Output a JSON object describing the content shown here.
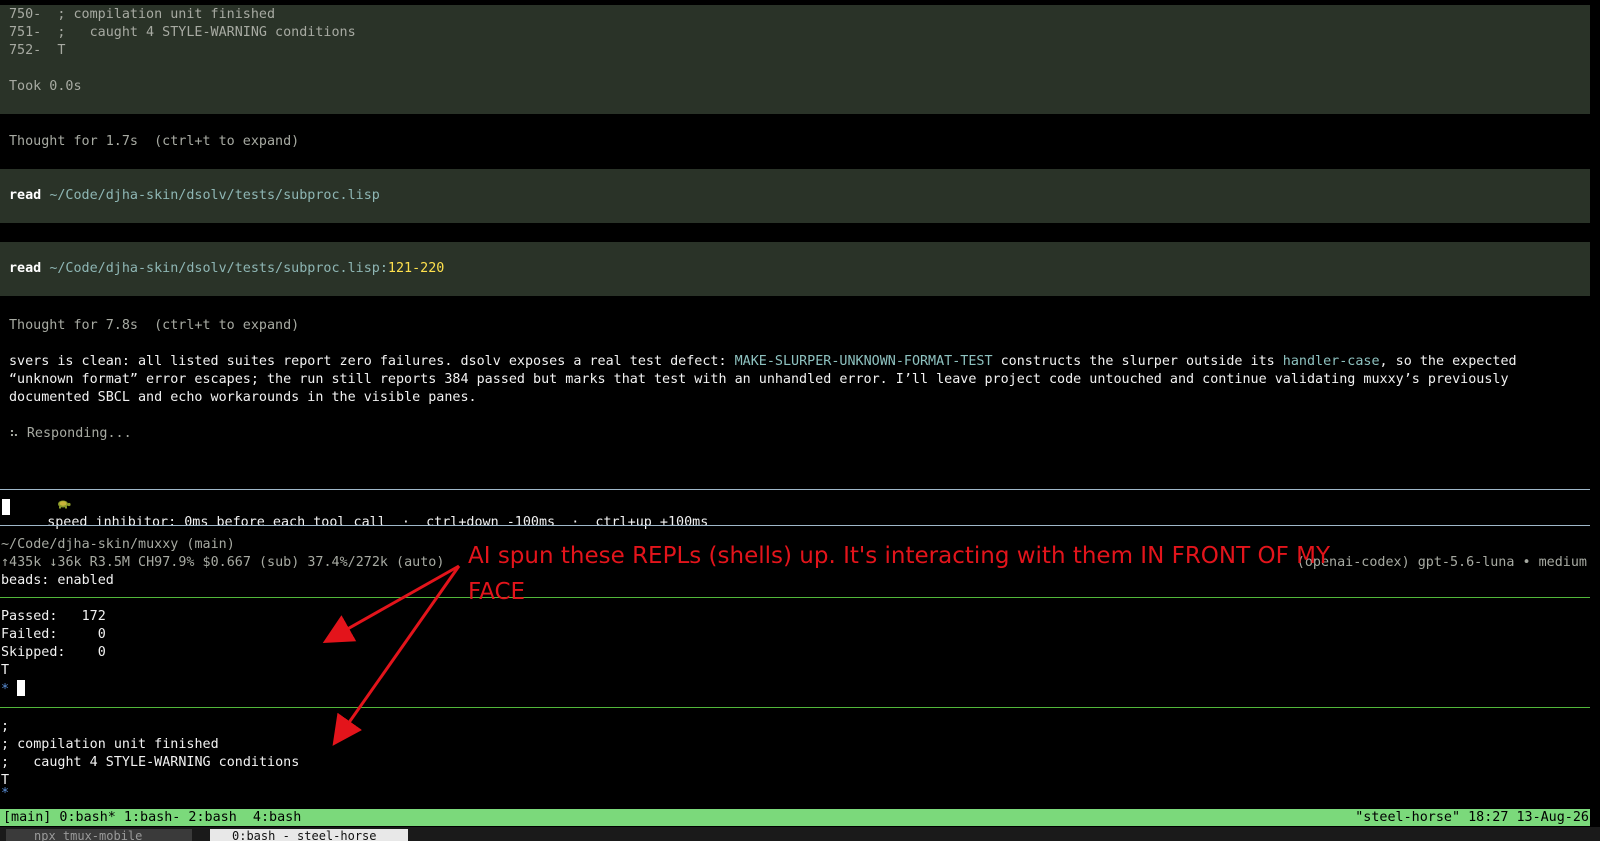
{
  "scrollback": {
    "lines": [
      "750-  ; compilation unit finished",
      "751-  ;   caught 4 STYLE-WARNING conditions",
      "752-  T"
    ],
    "took": "Took 0.0s"
  },
  "thought1": "Thought for 1.7s  (ctrl+t to expand)",
  "read1": {
    "cmd": "read",
    "path": "~/Code/djha-skin/dsolv/tests/subproc.lisp"
  },
  "read2": {
    "cmd": "read",
    "path": "~/Code/djha-skin/dsolv/tests/subproc.lisp",
    "sep": ":",
    "range": "121-220"
  },
  "thought2": "Thought for 7.8s  (ctrl+t to expand)",
  "message": {
    "l1a": "svers is clean: all listed suites report zero failures. dsolv exposes a real test defect: ",
    "l1code1": "MAKE-SLURPER-UNKNOWN-FORMAT-TEST",
    "l1b": " constructs the slurper outside its ",
    "l1code2": "handler-case",
    "l1c": ", so the expected",
    "l2": "“unknown format” error escapes; the run still reports 384 passed but marks that test with an unhandled error. I’ll leave project code untouched and continue validating muxxy’s previously",
    "l3": "documented SBCL and echo workarounds in the visible panes."
  },
  "responding": {
    "spinner": "⠦",
    "text": "Responding..."
  },
  "speed": {
    "icon": "turtle-icon",
    "text": "speed inhibitor: 0ms before each tool call  ·  ctrl+down -100ms  ·  ctrl+up +100ms"
  },
  "status": {
    "cwd": "~/Code/djha-skin/muxxy (main)",
    "stats": "↑435k ↓36k R3.5M CH97.9% $0.667 (sub) 37.4%/272k (auto)",
    "model": "(openai-codex) gpt-5.6-luna • medium",
    "beads": "beads: enabled"
  },
  "pane2": {
    "passed_label": "Passed:",
    "passed": "172",
    "failed_label": "Failed:",
    "failed": "0",
    "skipped_label": "Skipped:",
    "skipped": "0",
    "result": "T",
    "prompt": "*"
  },
  "pane3": {
    "lines": [
      ";",
      "; compilation unit finished",
      ";   caught 4 STYLE-WARNING conditions",
      "T"
    ],
    "prompt": "*"
  },
  "annotation": {
    "line1": "AI spun these REPLs (shells) up. It's interacting with them IN FRONT OF MY",
    "line2": "FACE",
    "color": "#e3141b"
  },
  "tmux": {
    "left": "[main] 0:bash* 1:bash- 2:bash  4:bash",
    "right": "\"steel-horse\" 18:27 13-Aug-26",
    "bg": "#7bd97b"
  },
  "tabs": {
    "tab1": "npx tmux-mobile",
    "tab2": "0:bash - steel-horse"
  }
}
